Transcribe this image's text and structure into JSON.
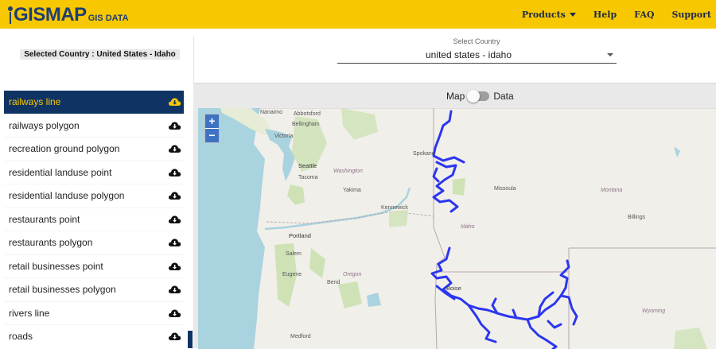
{
  "header": {
    "logo_text": "GISMAP",
    "logo_sub": "GIS DATA",
    "nav": [
      {
        "label": "Products",
        "dropdown": true
      },
      {
        "label": "Help"
      },
      {
        "label": "FAQ"
      },
      {
        "label": "Support"
      }
    ]
  },
  "selection": {
    "selected_country_label": "Selected Country : United States - Idaho",
    "select_title": "Select Country",
    "select_value": "united states - idaho"
  },
  "sidebar": {
    "items": [
      {
        "label": "railways line",
        "active": true
      },
      {
        "label": "railways polygon"
      },
      {
        "label": "recreation ground polygon"
      },
      {
        "label": "residential landuse point"
      },
      {
        "label": "residential landuse polygon"
      },
      {
        "label": "restaurants point"
      },
      {
        "label": "restaurants polygon"
      },
      {
        "label": "retail businesses point"
      },
      {
        "label": "retail businesses polygon"
      },
      {
        "label": "rivers line"
      },
      {
        "label": "roads"
      }
    ]
  },
  "view_toggle": {
    "left_label": "Map",
    "right_label": "Data",
    "selected": "Map"
  },
  "map": {
    "zoom_in": "+",
    "zoom_out": "−",
    "places": [
      {
        "key": "nanaimo",
        "label": "Nanaimo",
        "type": "town"
      },
      {
        "key": "abbotsford",
        "label": "Abbotsford",
        "type": "town"
      },
      {
        "key": "bellingham",
        "label": "Bellingham",
        "type": "town"
      },
      {
        "key": "victoria",
        "label": "Victoria",
        "type": "town"
      },
      {
        "key": "spokane",
        "label": "Spokane",
        "type": "town"
      },
      {
        "key": "seattle",
        "label": "Seattle",
        "type": "city"
      },
      {
        "key": "washington",
        "label": "Washington",
        "type": "state"
      },
      {
        "key": "tacoma",
        "label": "Tacoma",
        "type": "town"
      },
      {
        "key": "yakima",
        "label": "Yakima",
        "type": "town"
      },
      {
        "key": "missoula",
        "label": "Missoula",
        "type": "town"
      },
      {
        "key": "montana",
        "label": "Montana",
        "type": "state"
      },
      {
        "key": "kennewick",
        "label": "Kennewick",
        "type": "town"
      },
      {
        "key": "billings",
        "label": "Billings",
        "type": "town"
      },
      {
        "key": "idaho",
        "label": "Idaho",
        "type": "state"
      },
      {
        "key": "portland",
        "label": "Portland",
        "type": "city"
      },
      {
        "key": "salem",
        "label": "Salem",
        "type": "town"
      },
      {
        "key": "eugene",
        "label": "Eugene",
        "type": "town"
      },
      {
        "key": "oregon",
        "label": "Oregon",
        "type": "state"
      },
      {
        "key": "bend",
        "label": "Bend",
        "type": "town"
      },
      {
        "key": "boise",
        "label": "Boise",
        "type": "city"
      },
      {
        "key": "wyoming",
        "label": "Wyoming",
        "type": "state"
      },
      {
        "key": "medford",
        "label": "Medford",
        "type": "town"
      }
    ],
    "colors": {
      "railway": "#2b36f0",
      "water": "#a9d3df",
      "land": "#f1efe9",
      "park": "#cfe2b6"
    }
  },
  "colors": {
    "brand_yellow": "#f7c800",
    "brand_navy": "#0f3463"
  }
}
